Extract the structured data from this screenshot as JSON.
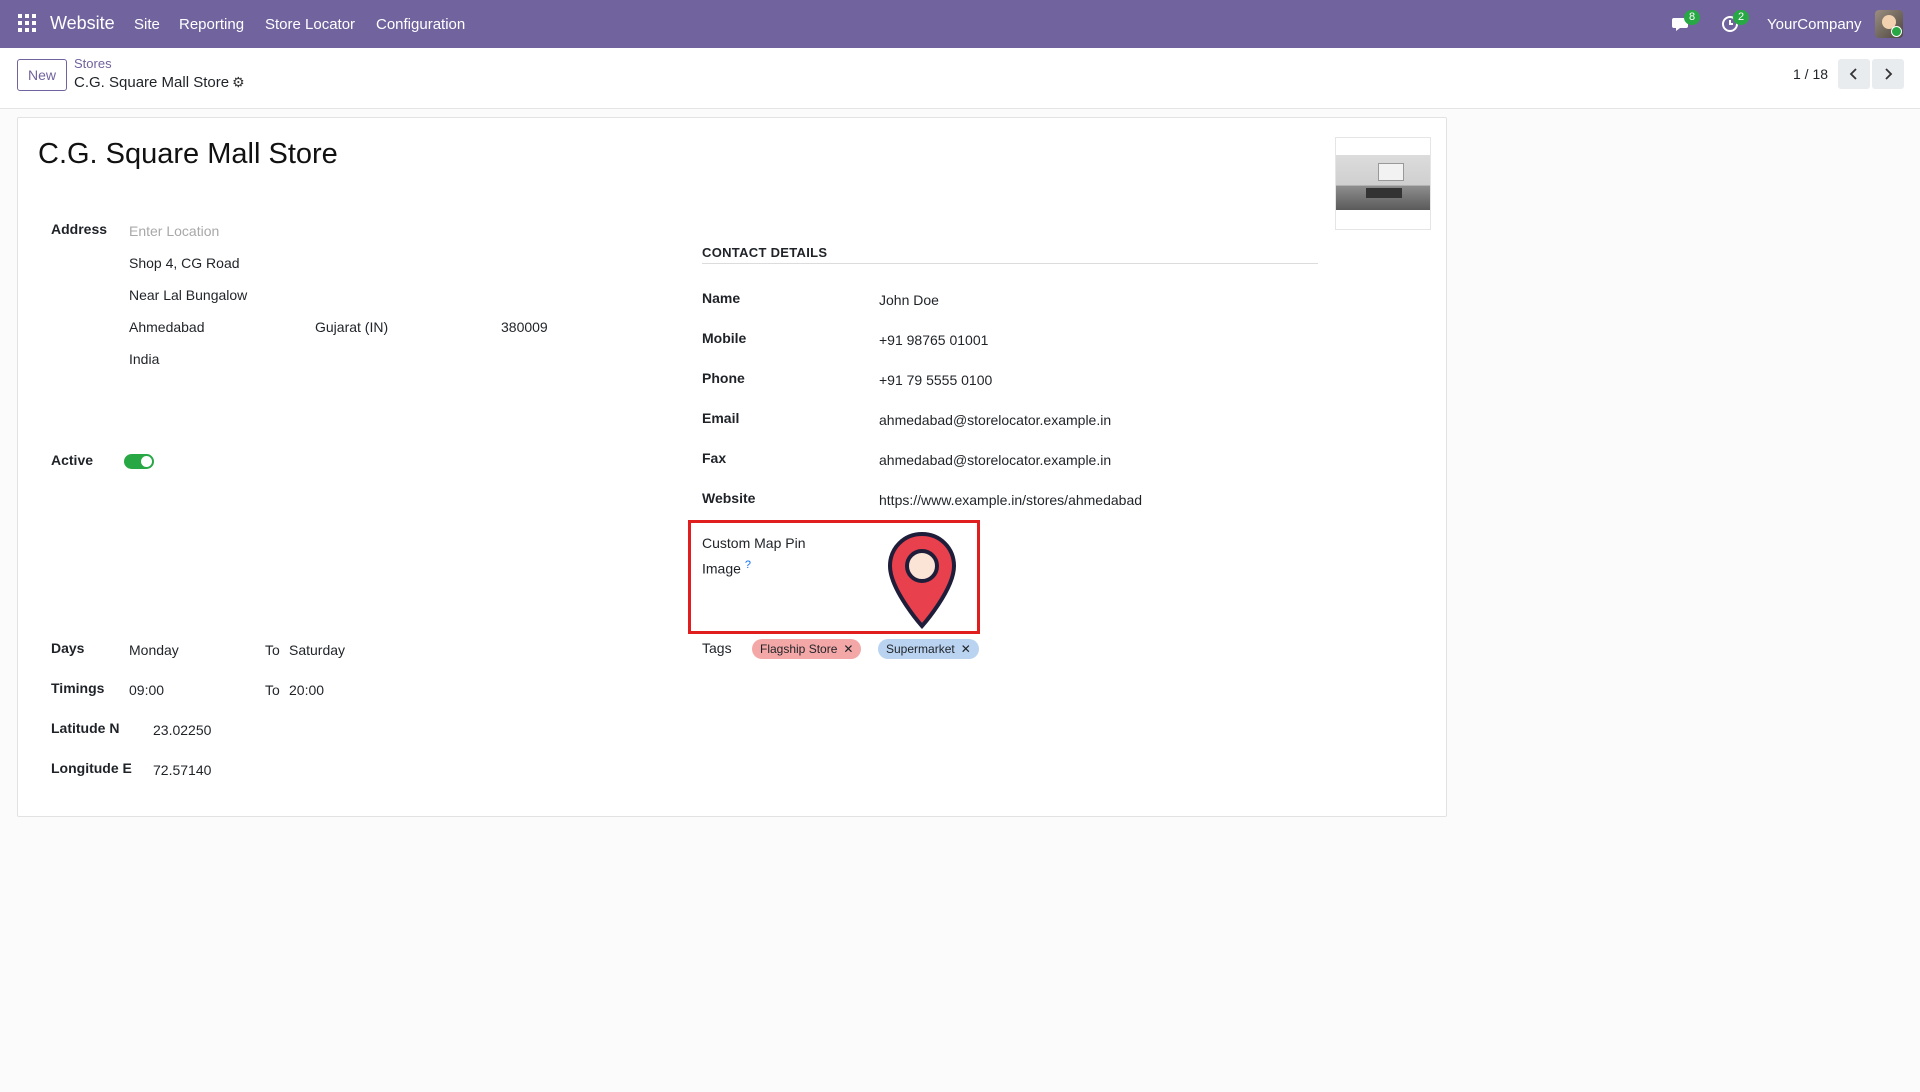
{
  "navbar": {
    "brand": "Website",
    "menus": [
      "Site",
      "Reporting",
      "Store Locator",
      "Configuration"
    ],
    "messages_count": "8",
    "activities_count": "2",
    "company": "YourCompany"
  },
  "control_panel": {
    "new_label": "New",
    "breadcrumb_parent": "Stores",
    "breadcrumb_current": "C.G. Square Mall Store",
    "pager": "1 / 18"
  },
  "record": {
    "title": "C.G. Square Mall Store",
    "address": {
      "label": "Address",
      "placeholder": "Enter Location",
      "street": "Shop 4, CG Road",
      "street2": "Near Lal Bungalow",
      "city": "Ahmedabad",
      "state": "Gujarat (IN)",
      "zip": "380009",
      "country": "India"
    },
    "active": {
      "label": "Active",
      "checked": true
    },
    "days": {
      "label": "Days",
      "from": "Monday",
      "to_label": "To",
      "to": "Saturday"
    },
    "timings": {
      "label": "Timings",
      "from": "09:00",
      "to_label": "To",
      "to": "20:00"
    },
    "latitude": {
      "label": "Latitude N",
      "value": "23.02250"
    },
    "longitude": {
      "label": "Longitude E",
      "value": "72.57140"
    },
    "contact": {
      "section_title": "CONTACT DETAILS",
      "name_label": "Name",
      "name": "John Doe",
      "mobile_label": "Mobile",
      "mobile": "+91 98765 01001",
      "phone_label": "Phone",
      "phone": "+91 79 5555 0100",
      "email_label": "Email",
      "email": "ahmedabad@storelocator.example.in",
      "fax_label": "Fax",
      "fax": "ahmedabad@storelocator.example.in",
      "website_label": "Website",
      "website": "https://www.example.in/stores/ahmedabad"
    },
    "map_pin": {
      "label_line1": "Custom Map Pin",
      "label_line2": "Image",
      "help": "?"
    },
    "tags": {
      "label": "Tags",
      "items": [
        {
          "name": "Flagship Store",
          "color": "#f4a7a7"
        },
        {
          "name": "Supermarket",
          "color": "#b9d3f0"
        }
      ]
    }
  },
  "colors": {
    "navbar": "#71639e",
    "accent": "#71639e",
    "toggle_on": "#28a745",
    "highlight": "#e01e1e",
    "pin_fill": "#e8404c",
    "pin_center": "#fbe3d6"
  },
  "icons": [
    "apps-grid-icon",
    "chat-icon",
    "clock-icon",
    "gear-icon",
    "chevron-left-icon",
    "chevron-right-icon",
    "map-pin-icon",
    "remove-x-icon"
  ]
}
